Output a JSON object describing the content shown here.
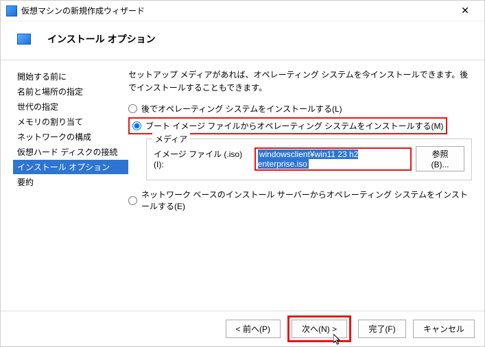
{
  "window": {
    "title": "仮想マシンの新規作成ウィザード",
    "close": "✕"
  },
  "header": {
    "title": "インストール オプション"
  },
  "sidebar": {
    "items": [
      {
        "label": "開始する前に"
      },
      {
        "label": "名前と場所の指定"
      },
      {
        "label": "世代の指定"
      },
      {
        "label": "メモリの割り当て"
      },
      {
        "label": "ネットワークの構成"
      },
      {
        "label": "仮想ハード ディスクの接続"
      },
      {
        "label": "インストール オプション",
        "active": true
      },
      {
        "label": "要約"
      }
    ]
  },
  "main": {
    "intro": "セットアップ メディアがあれば、オペレーティング システムを今インストールできます。後でインストールすることもできます。",
    "radio_later": "後でオペレーティング システムをインストールする(L)",
    "radio_boot": "ブート イメージ ファイルからオペレーティング システムをインストールする(M)",
    "group_title": "メディア",
    "iso_label": "イメージ ファイル (.iso)(I):",
    "iso_value": "windowsclient¥win11 23 h2 enterprise.iso",
    "browse": "参照(B)...",
    "radio_net": "ネットワーク ベースのインストール サーバーからオペレーティング システムをインストールする(E)"
  },
  "footer": {
    "prev": "< 前へ(P)",
    "next": "次へ(N) >",
    "finish": "完了(F)",
    "cancel": "キャンセル"
  }
}
